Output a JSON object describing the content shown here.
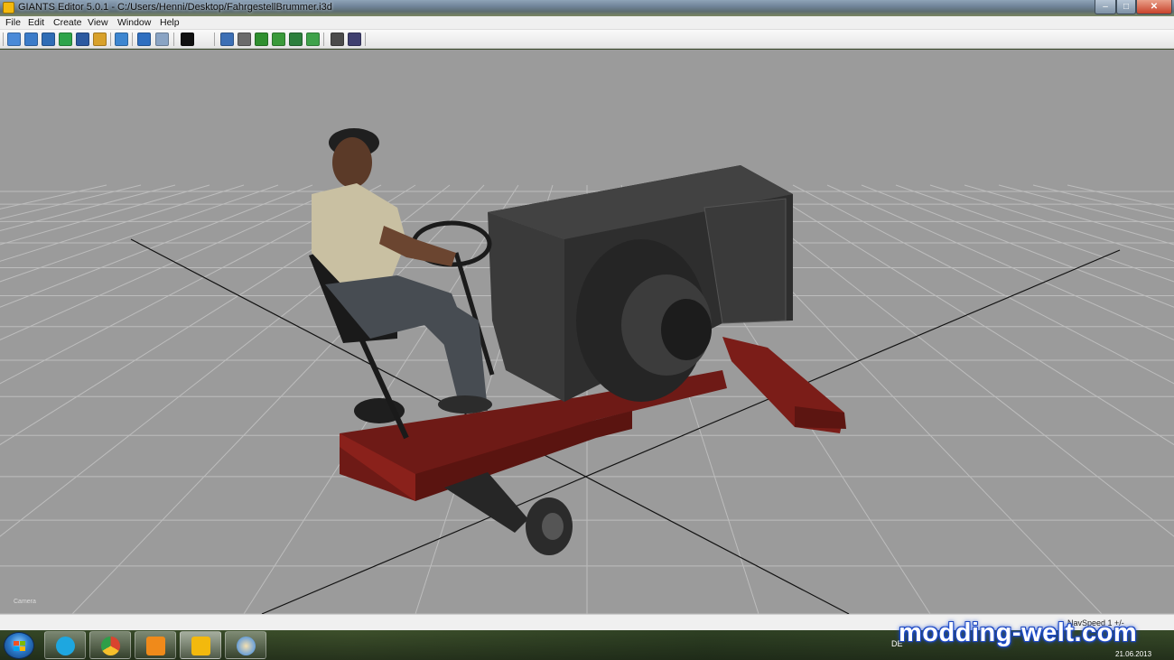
{
  "window": {
    "title": "GIANTS Editor 5.0.1 - C:/Users/Henni/Desktop/FahrgestellBrummer.i3d",
    "minimize_glyph": "–",
    "maximize_glyph": "□",
    "close_glyph": "✕"
  },
  "menu": {
    "items": [
      {
        "label": "File"
      },
      {
        "label": "Edit"
      },
      {
        "label": "Create"
      },
      {
        "label": "View"
      },
      {
        "label": "Window"
      },
      {
        "label": "Help"
      }
    ]
  },
  "toolbar": {
    "buttons": [
      {
        "name": "new-icon",
        "color": "#4a8ad8"
      },
      {
        "name": "open-icon",
        "color": "#3b7cc9"
      },
      {
        "name": "import-icon",
        "color": "#2f6db5"
      },
      {
        "name": "reload-icon",
        "color": "#2ea44a"
      },
      {
        "name": "save-icon",
        "color": "#2c5aa0"
      },
      {
        "name": "save-all-icon",
        "color": "#d8a12a"
      },
      {
        "name": "select-icon",
        "color": "#3d86d0"
      },
      {
        "name": "undo-icon",
        "color": "#2f6fc0"
      },
      {
        "name": "redo-icon",
        "color": "#8aa4c4"
      },
      {
        "name": "play-icon",
        "color": "#111111"
      },
      {
        "name": "home-icon",
        "color": "#3c6fb5"
      },
      {
        "name": "magnet-icon",
        "color": "#6b6b6b"
      },
      {
        "name": "terrain-raise-icon",
        "color": "#2f8f2f"
      },
      {
        "name": "terrain-lower-icon",
        "color": "#3a9a3a"
      },
      {
        "name": "terrain-smooth-icon",
        "color": "#2c7f3c"
      },
      {
        "name": "foliage-paint-icon",
        "color": "#3fa24a"
      },
      {
        "name": "texture-paint-icon",
        "color": "#4b4b4b"
      },
      {
        "name": "terrain-detail-icon",
        "color": "#3f3f6f"
      }
    ]
  },
  "viewport": {
    "camera_label": "Camera",
    "background": "#9b9b9b",
    "grid_color": "#bdbdbd",
    "axis_color": "#111111"
  },
  "statusbar": {
    "nav_speed": "NavSpeed 1 +/-"
  },
  "taskbar": {
    "apps": [
      {
        "name": "skype-icon",
        "color": "#1ea7e0"
      },
      {
        "name": "chrome-icon",
        "color": "#d9432f"
      },
      {
        "name": "media-player-icon",
        "color": "#f08a1a"
      },
      {
        "name": "giants-editor-icon",
        "color": "#f3b90d"
      },
      {
        "name": "paint-icon",
        "color": "#6aa0d8"
      }
    ],
    "tray_lang": "DE",
    "date": "21.06.2013"
  },
  "watermark": "modding-welt.com"
}
